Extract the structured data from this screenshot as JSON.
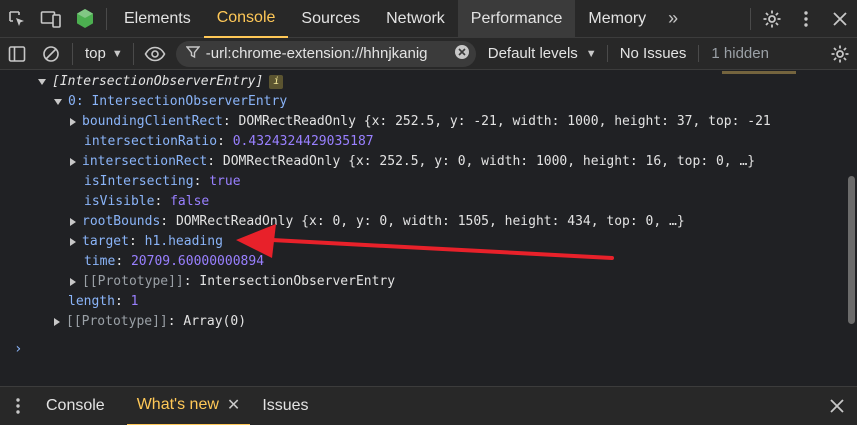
{
  "tabs": [
    {
      "label": "Elements"
    },
    {
      "label": "Console"
    },
    {
      "label": "Sources"
    },
    {
      "label": "Network"
    },
    {
      "label": "Performance"
    },
    {
      "label": "Memory"
    }
  ],
  "toolbar": {
    "context": "top",
    "filter_value": "-url:chrome-extension://hhnjkanig",
    "levels": "Default levels",
    "issues": "No Issues",
    "hidden": "1 hidden"
  },
  "console": {
    "header": "[IntersectionObserverEntry]",
    "info_badge": "i",
    "entry_key": "0: IntersectionObserverEntry",
    "bcr_key": "boundingClientRect",
    "bcr_value": "DOMRectReadOnly {x: 252.5, y: -21, width: 1000, height: 37, top: -21",
    "ratio_key": "intersectionRatio",
    "ratio_value": "0.4324324429035187",
    "irect_key": "intersectionRect",
    "irect_value": "DOMRectReadOnly {x: 252.5, y: 0, width: 1000, height: 16, top: 0, …}",
    "isint_key": "isIntersecting",
    "isint_value": "true",
    "isvis_key": "isVisible",
    "isvis_value": "false",
    "root_key": "rootBounds",
    "root_value": "DOMRectReadOnly {x: 0, y: 0, width: 1505, height: 434, top: 0, …}",
    "target_key": "target",
    "target_value": "h1.heading",
    "time_key": "time",
    "time_value": "20709.60000000894",
    "proto_key": "[[Prototype]]",
    "proto_value": "IntersectionObserverEntry",
    "length_key": "length",
    "length_value": "1",
    "arr_proto_key": "[[Prototype]]",
    "arr_proto_value": "Array(0)",
    "prompt": "›"
  },
  "drawer": {
    "tabs": [
      {
        "label": "Console"
      },
      {
        "label": "What's new"
      },
      {
        "label": "Issues"
      }
    ]
  },
  "colors": {
    "accent": "#ffc857",
    "annotation_arrow": "#e8212a"
  }
}
